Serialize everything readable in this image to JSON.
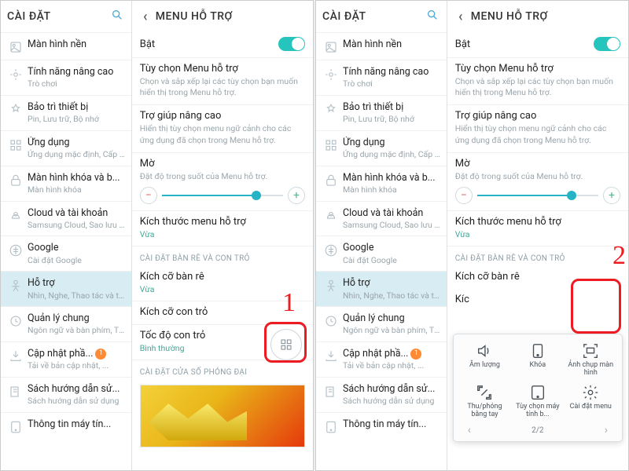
{
  "settings_title": "CÀI ĐẶT",
  "menu_title": "MENU HỖ TRỢ",
  "sidebar": [
    {
      "t": "Màn hình nền",
      "s": ""
    },
    {
      "t": "Tính năng nâng cao",
      "s": "Trò chơi"
    },
    {
      "t": "Bảo trì thiết bị",
      "s": "Pin, Lưu trữ, Bộ nhớ"
    },
    {
      "t": "Ứng dụng",
      "s": "Ứng dụng mặc định, Cấp qu..."
    },
    {
      "t": "Màn hình khóa và b...",
      "s": "Màn hình khóa"
    },
    {
      "t": "Cloud và tài khoản",
      "s": "Samsung Cloud, Sao lưu và..."
    },
    {
      "t": "Google",
      "s": "Cài đặt Google"
    },
    {
      "t": "Hỗ trợ",
      "s": "Nhìn, Nghe, Thao tác và tươ..."
    },
    {
      "t": "Quản lý chung",
      "s": "Ngôn ngữ và bàn phím, Thờ..."
    },
    {
      "t": "Cập nhật phầ...",
      "s": "Tải về bản cập nhật, ..."
    },
    {
      "t": "Sách hướng dẫn sử...",
      "s": "Sách hướng dẫn sử dụng"
    },
    {
      "t": "Thông tin máy tín...",
      "s": ""
    }
  ],
  "sidebar2_4": "Màn hình khóa và b...",
  "on_label": "Bật",
  "sec": {
    "opt_t": "Tùy chọn Menu hỗ trợ",
    "opt_s": "Chọn và sắp xếp lại các tùy chọn bạn muốn hiển thị trong Menu hỗ trợ.",
    "help_t": "Trợ giúp nâng cao",
    "help_s": "Hiển thị tùy chọn menu ngữ cảnh cho các ứng dụng đã chọn trong Menu hỗ trợ.",
    "opac_t": "Mờ",
    "opac_s": "Đặt độ trong suốt của Menu hỗ trợ.",
    "size_t": "Kích thước menu hỗ trợ",
    "size_v": "Vừa",
    "h1": "CÀI ĐẶT BÀN RÊ VÀ CON TRỎ",
    "pad_t": "Kích cỡ bàn rê",
    "pad_v": "Vừa",
    "cur_t": "Kích cỡ con trỏ",
    "spd_t": "Tốc độ con trỏ",
    "spd_v": "Bình thường",
    "h2": "CÀI ĐẶT CỬA SỐ PHÓNG ĐẠI"
  },
  "popup": {
    "vol": "Âm lượng",
    "lock": "Khóa",
    "shot": "Ảnh chụp màn hình",
    "zoom": "Thu/phóng bằng tay",
    "tablet": "Tùy chọn máy tính b...",
    "set": "Cài đặt menu",
    "page": "2/2"
  },
  "callout1": "1",
  "callout2": "2"
}
